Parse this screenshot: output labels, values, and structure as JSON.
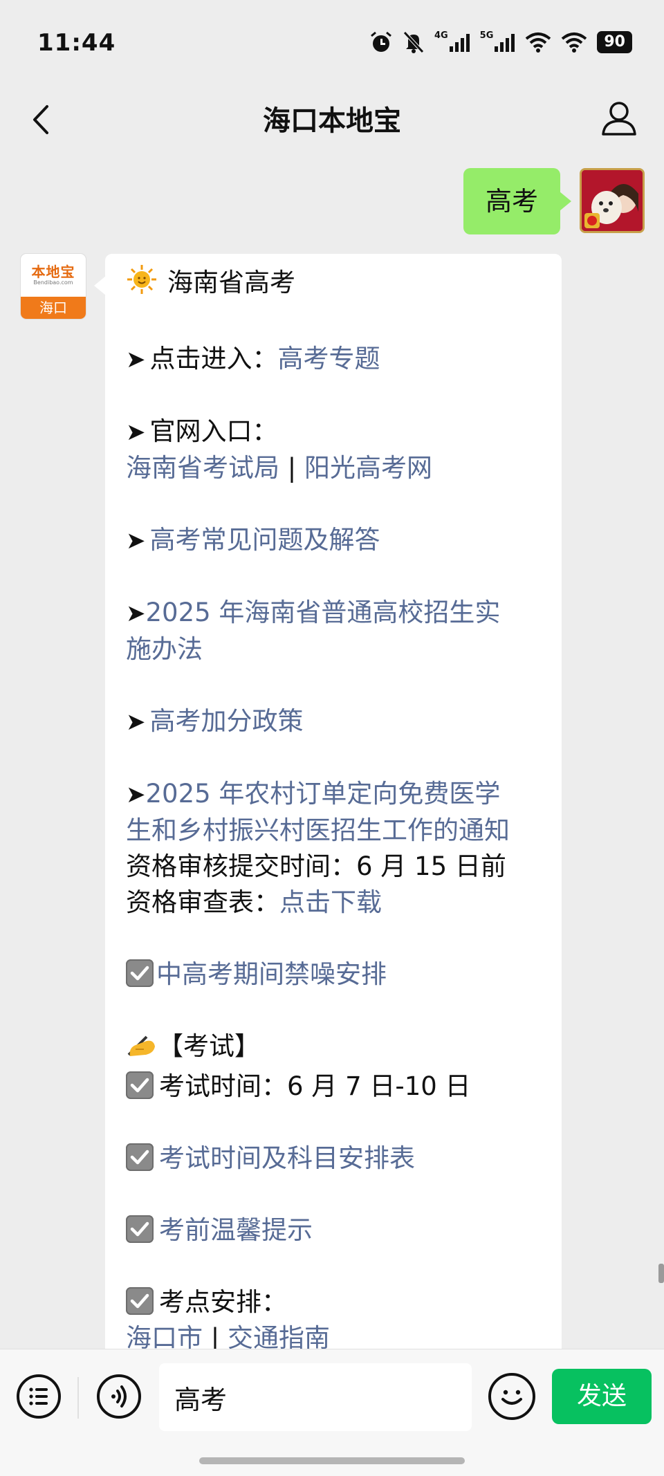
{
  "status_bar": {
    "time": "11:44",
    "network_1": "4G",
    "network_2": "5G",
    "battery": "90",
    "icons": [
      "alarm-icon",
      "mute-icon",
      "signal-icon",
      "signal-icon",
      "wifi-icon",
      "wifi-icon",
      "battery-icon"
    ]
  },
  "header": {
    "title": "海口本地宝",
    "back_icon": "chevron-left-icon",
    "profile_icon": "person-icon"
  },
  "chat": {
    "sent_message": "高考",
    "bot_avatar": {
      "brand": "本地宝",
      "brand_sub": "Bendibao.com",
      "city": "海口"
    },
    "reply": {
      "title": "海南省高考",
      "l1_prefix": "点击进入：",
      "l1_link": "高考专题",
      "l2_prefix": "官网入口：",
      "l2_link_a": "海南省考试局",
      "l2_sep": " | ",
      "l2_link_b": "阳光高考网",
      "l3_link": "高考常见问题及解答",
      "l4_link_line1": "2025 年海南省普通高校招生实",
      "l4_link_line2": "施办法",
      "l5_link": "高考加分政策",
      "l6_link_line1": "2025 年农村订单定向免费医学",
      "l6_link_line2": "生和乡村振兴村医招生工作的通知",
      "l6_text1": "资格审核提交时间：6 月 15 日前",
      "l6_text2_prefix": "资格审查表：",
      "l6_text2_link": "点击下载",
      "l7_link": "中高考期间禁噪安排",
      "exam_header": "【考试】",
      "exam_time": "考试时间：6 月 7 日-10 日",
      "exam_schedule_link": "考试时间及科目安排表",
      "exam_tips_link": "考前温馨提示",
      "exam_site_prefix": "考点安排：",
      "exam_site_link_a": "海口市",
      "exam_site_sep": " | ",
      "exam_site_link_b": "交通指南"
    }
  },
  "input_bar": {
    "value": "高考",
    "send_label": "发送",
    "icons": [
      "menu-list-icon",
      "voice-icon",
      "emoji-icon"
    ]
  },
  "colors": {
    "link": "#576b95",
    "sent_bubble": "#95ec69",
    "send_button": "#07c160",
    "bot_brand": "#f07a1a"
  }
}
